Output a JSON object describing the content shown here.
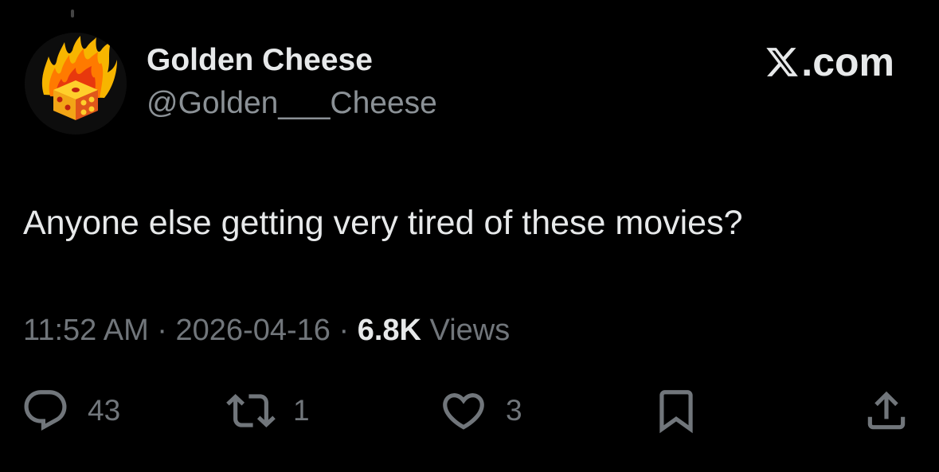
{
  "author": {
    "display_name": "Golden Cheese",
    "handle": "@Golden___Cheese",
    "avatar_icon": "flaming-dice-icon"
  },
  "brand": {
    "label": ".com",
    "icon": "x-logo-icon"
  },
  "tweet": {
    "text": "Anyone else getting very tired of these movies?"
  },
  "meta": {
    "time": "11:52 AM",
    "separator": "·",
    "date": "2026-04-16",
    "views_count": "6.8K",
    "views_label": "Views"
  },
  "actions": {
    "replies": {
      "icon": "reply-icon",
      "count": "43"
    },
    "retweets": {
      "icon": "retweet-icon",
      "count": "1"
    },
    "likes": {
      "icon": "heart-icon",
      "count": "3"
    },
    "bookmark": {
      "icon": "bookmark-icon"
    },
    "share": {
      "icon": "share-icon"
    }
  },
  "colors": {
    "background": "#000000",
    "primary_text": "#e7e9ea",
    "secondary_text": "#71767b"
  }
}
